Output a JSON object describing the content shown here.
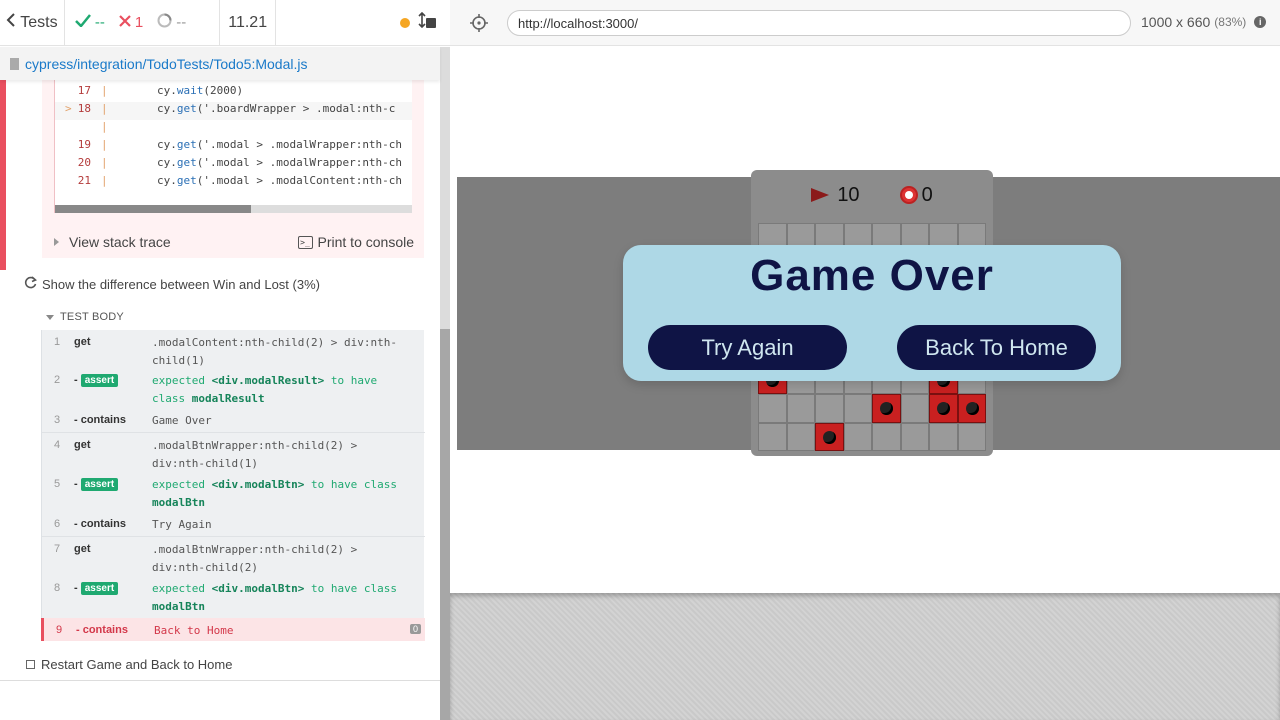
{
  "header": {
    "tests_label": "Tests",
    "passed": "--",
    "failed": "1",
    "pending": "--",
    "duration": "11.21"
  },
  "spec": {
    "path": "cypress/integration/TodoTests/Todo5:Modal.js"
  },
  "code_frame": {
    "lines": [
      {
        "num": "17",
        "text_fn": "wait",
        "pre": "cy.",
        "post": "(2000)"
      },
      {
        "num": "18",
        "pre": "cy.",
        "text_fn": "get",
        "post": "('.boardWrapper > .modal:nth-c",
        "marker": ">"
      },
      {
        "num": "",
        "pre": "",
        "text_fn": "",
        "post": ""
      },
      {
        "num": "19",
        "pre": "cy.",
        "text_fn": "get",
        "post": "('.modal > .modalWrapper:nth-ch"
      },
      {
        "num": "20",
        "pre": "cy.",
        "text_fn": "get",
        "post": "('.modal > .modalWrapper:nth-ch"
      },
      {
        "num": "21",
        "pre": "cy.",
        "text_fn": "get",
        "post": "('.modal > .modalContent:nth-ch"
      }
    ],
    "view_stack_trace": "View stack trace",
    "print_to_console": "Print to console"
  },
  "test": {
    "title": "Show the difference between Win and Lost (3%)",
    "body_label": "TEST BODY"
  },
  "commands": [
    {
      "num": "1",
      "name": "get",
      "message": ".modalContent:nth-child(2) > div:nth-child(1)"
    },
    {
      "num": "2",
      "name": "- assert",
      "pre": "expected ",
      "el": "<div.modalResult>",
      "mid": " to have class ",
      "val": "modalResult"
    },
    {
      "num": "3",
      "name": "- contains",
      "message": "Game Over"
    },
    {
      "num": "4",
      "name": "get",
      "message": ".modalBtnWrapper:nth-child(2) > div:nth-child(1)"
    },
    {
      "num": "5",
      "name": "- assert",
      "pre": "expected ",
      "el": "<div.modalBtn>",
      "mid": " to have class ",
      "val": "modalBtn"
    },
    {
      "num": "6",
      "name": "- contains",
      "message": "Try Again"
    },
    {
      "num": "7",
      "name": "get",
      "message": ".modalBtnWrapper:nth-child(2) > div:nth-child(2)"
    },
    {
      "num": "8",
      "name": "- assert",
      "pre": "expected ",
      "el": "<div.modalBtn>",
      "mid": " to have class ",
      "val": "modalBtn"
    },
    {
      "num": "9",
      "name": "- contains",
      "message": "Back to Home",
      "count": "0"
    }
  ],
  "next_test": "Restart Game and Back to Home",
  "aut": {
    "url": "http://localhost:3000/",
    "viewport": "1000 x 660",
    "scale": "(83%)"
  },
  "game": {
    "flags": "10",
    "timer": "0",
    "modal_title": "Game Over",
    "try_again": "Try Again",
    "back_home": "Back To Home"
  },
  "colors": {
    "pass": "#1fa971",
    "fail": "#e94f5f",
    "modal_bg": "#aed8e6",
    "modal_text": "#0f1445"
  }
}
